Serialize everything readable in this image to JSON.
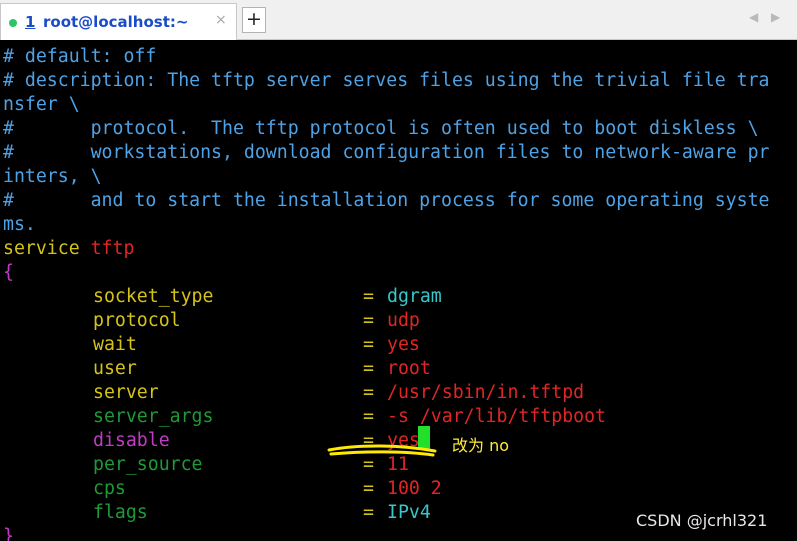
{
  "tab": {
    "number": "1",
    "title": "root@localhost:~",
    "close_glyph": "×",
    "status_color": "#2fc36a"
  },
  "toolbar": {
    "new_tab_label": "+",
    "prev_label": "◀",
    "next_label": "▶"
  },
  "terminal": {
    "lines": [
      "# default: off",
      "# description: The tftp server serves files using the trivial file tra",
      "nsfer \\",
      "#       protocol.  The tftp protocol is often used to boot diskless \\",
      "#       workstations, download configuration files to network-aware pr",
      "inters, \\",
      "#       and to start the installation process for some operating syste",
      "ms."
    ],
    "service_keyword": "service",
    "service_name": "tftp",
    "open_brace": "{",
    "close_brace": "}",
    "equals": "=",
    "entries": [
      {
        "key": "socket_type",
        "value": "dgram"
      },
      {
        "key": "protocol",
        "value": "udp"
      },
      {
        "key": "wait",
        "value": "yes"
      },
      {
        "key": "user",
        "value": "root"
      },
      {
        "key": "server",
        "value": "/usr/sbin/in.tftpd"
      },
      {
        "key": "server_args",
        "value": "-s /var/lib/tftpboot"
      },
      {
        "key": "disable",
        "value": "yes"
      },
      {
        "key": "per_source",
        "value": "11"
      },
      {
        "key": "cps",
        "value": "100 2"
      },
      {
        "key": "flags",
        "value": "IPv4"
      }
    ]
  },
  "annotation": {
    "note": "改为 no",
    "note_color": "#ffec3a",
    "underline_color": "#ffea00"
  },
  "watermark": "CSDN @jcrhl321"
}
